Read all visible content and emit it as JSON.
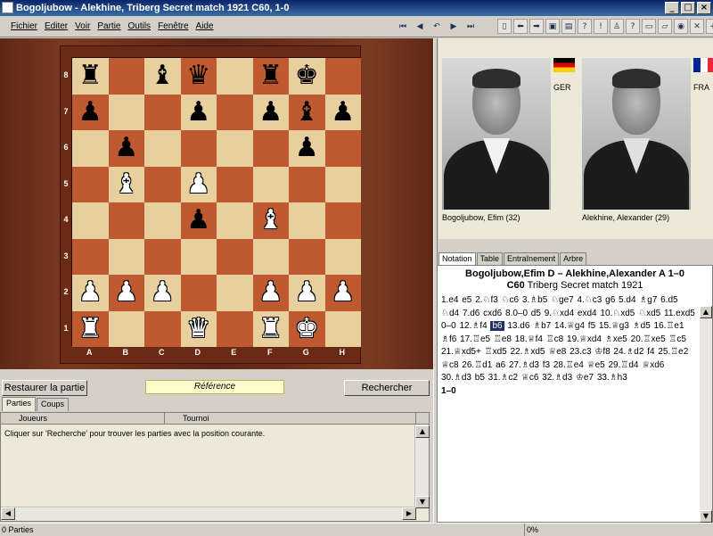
{
  "window": {
    "title": "Bogoljubow - Alekhine, Triberg Secret match 1921  C60, 1-0"
  },
  "menu": [
    "Fichier",
    "Editer",
    "Voir",
    "Partie",
    "Outils",
    "Fenêtre",
    "Aide"
  ],
  "board": {
    "files": [
      "A",
      "B",
      "C",
      "D",
      "E",
      "F",
      "G",
      "H"
    ],
    "ranks": [
      "8",
      "7",
      "6",
      "5",
      "4",
      "3",
      "2",
      "1"
    ],
    "position": [
      [
        "r",
        "",
        "b",
        "q",
        "",
        "r",
        "k",
        ""
      ],
      [
        "p",
        "",
        "",
        "p",
        "",
        "p",
        "b",
        "p"
      ],
      [
        "",
        "p",
        "",
        "",
        "",
        "",
        "p",
        ""
      ],
      [
        "",
        "B",
        "",
        "P",
        "",
        "",
        "",
        ""
      ],
      [
        "",
        "",
        "",
        "p",
        "",
        "B",
        "",
        ""
      ],
      [
        "",
        "",
        "",
        "",
        "",
        "",
        "",
        ""
      ],
      [
        "P",
        "P",
        "P",
        "",
        "",
        "P",
        "P",
        "P"
      ],
      [
        "R",
        "",
        "",
        "Q",
        "",
        "R",
        "K",
        ""
      ]
    ],
    "colors": {
      "light": "#e8cf9e",
      "dark": "#bf5a30"
    }
  },
  "controls": {
    "restore": "Restaurer la partie",
    "reference": "Référence",
    "search": "Rechercher"
  },
  "games_tabs": [
    "Parties",
    "Coups"
  ],
  "games_list": {
    "columns": [
      "Joueurs",
      "Tournoi"
    ],
    "message": "Cliquer sur 'Recherche' pour trouver les parties avec la position courante."
  },
  "status": {
    "left": "0 Parties",
    "progress": "0%"
  },
  "players": {
    "white": {
      "name": "Bogoljubow, Efim  (32)",
      "country": "GER"
    },
    "black": {
      "name": "Alekhine, Alexander  (29)",
      "country": "FRA"
    }
  },
  "notation_tabs": [
    "Notation",
    "Table",
    "Entraînement",
    "Arbre"
  ],
  "game": {
    "header": "Bogoljubow,Efim D – Alekhine,Alexander A  1–0",
    "eco": "C60",
    "event": "Triberg Secret match 1921",
    "moves_before": "1.e4  e5  2.♘f3  ♘c6  3.♗b5  ♘ge7  4.♘c3  g6  5.d4  ♗g7  6.d5  ♘d4  7.d6  cxd6  8.0–0  d5  9.♘xd4  exd4  10.♘xd5  ♘xd5  11.exd5  0–0  12.♗f4 ",
    "highlight": "b6",
    "moves_after": " 13.d6  ♗b7  14.♕g4  f5  15.♕g3  ♗d5  16.♖e1  ♗f6  17.♖e5  ♖e8  18.♕f4  ♖c8  19.♕xd4  ♗xe5  20.♖xe5  ♖c5  21.♕xd5+  ♖xd5  22.♗xd5  ♕e8  23.c3  ♔f8  24.♗d2  f4  25.♖e2  ♕c8  26.♖d1  a6  27.♗d3  f3  28.♖e4  ♕e5  29.♖d4  ♕xd6  30.♗d3  b5  31.♗c2  ♕c6  32.♗d3  ♔e7  33.♗h3",
    "result": "1–0"
  }
}
